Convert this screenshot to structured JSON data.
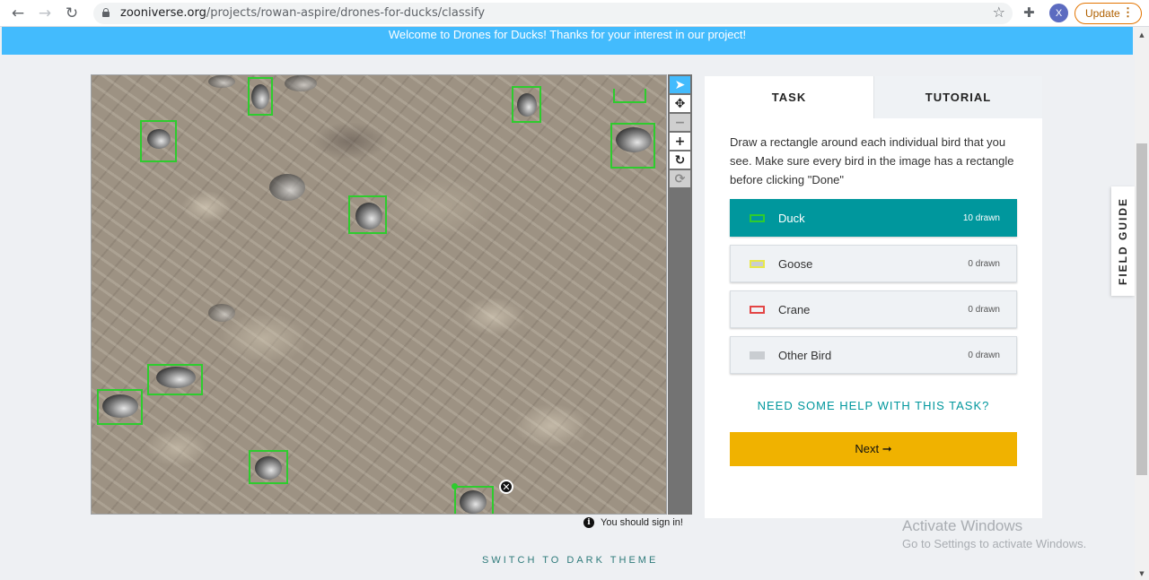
{
  "browser": {
    "url_host": "zooniverse.org",
    "url_path": "/projects/rowan-aspire/drones-for-ducks/classify",
    "profile_initial": "X",
    "update_label": "Update"
  },
  "banner": {
    "text": "Welcome to Drones for Ducks! Thanks for your interest in our project!"
  },
  "viewer": {
    "drawn_rectangles": 10,
    "signin_notice": "You should sign in!"
  },
  "task_panel": {
    "tabs": [
      {
        "label": "TASK",
        "active": true
      },
      {
        "label": "TUTORIAL",
        "active": false
      }
    ],
    "instructions": "Draw a rectangle around each individual bird that you see. Make sure every bird in the image has a rectangle before clicking \"Done\"",
    "answers": [
      {
        "label": "Duck",
        "count": "10 drawn",
        "color": "#2ecc2e",
        "selected": true
      },
      {
        "label": "Goose",
        "count": "0 drawn",
        "color": "#e8e84a",
        "selected": false
      },
      {
        "label": "Crane",
        "count": "0 drawn",
        "color": "#e34545",
        "selected": false
      },
      {
        "label": "Other Bird",
        "count": "0 drawn",
        "color": "#c9cdd1",
        "selected": false
      }
    ],
    "help_link": "NEED SOME HELP WITH THIS TASK?",
    "next_label": "Next ➞"
  },
  "field_guide": {
    "label": "FIELD GUIDE"
  },
  "footer": {
    "dark_theme_label": "SWITCH TO DARK THEME"
  },
  "watermark": {
    "line1": "Activate Windows",
    "line2": "Go to Settings to activate Windows."
  },
  "colors": {
    "accent": "#00979d",
    "banner": "#43bbfd",
    "next_button": "#f0b200",
    "duck_box": "#2ecc2e"
  }
}
